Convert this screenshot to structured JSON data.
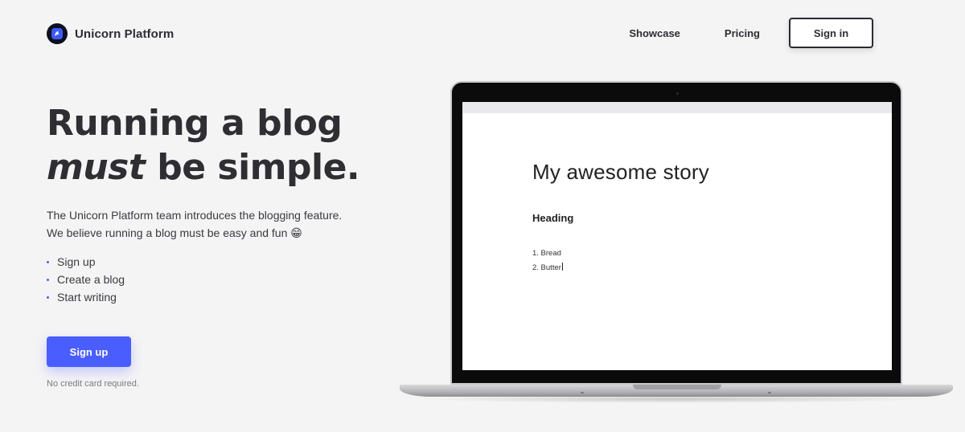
{
  "header": {
    "brand": "Unicorn Platform",
    "nav": {
      "showcase": "Showcase",
      "pricing": "Pricing",
      "signin": "Sign in"
    }
  },
  "hero": {
    "title_line1": "Running a blog",
    "title_em": "must",
    "title_line2_rest": " be simple.",
    "subtitle_line1": "The Unicorn Platform team introduces the blogging feature.",
    "subtitle_line2": "We believe running a blog must be easy and fun 😁",
    "list": [
      "Sign up",
      "Create a blog",
      "Start writing"
    ],
    "cta": "Sign up",
    "note": "No credit card required."
  },
  "laptop_screen": {
    "story_title": "My awesome story",
    "heading": "Heading",
    "items": [
      "1. Bread",
      "2. Butter"
    ]
  },
  "colors": {
    "accent": "#4a5dff",
    "background": "#f4f4f5",
    "text": "#2e2e33"
  },
  "icons": {
    "logo": "unicorn-logo-icon"
  }
}
